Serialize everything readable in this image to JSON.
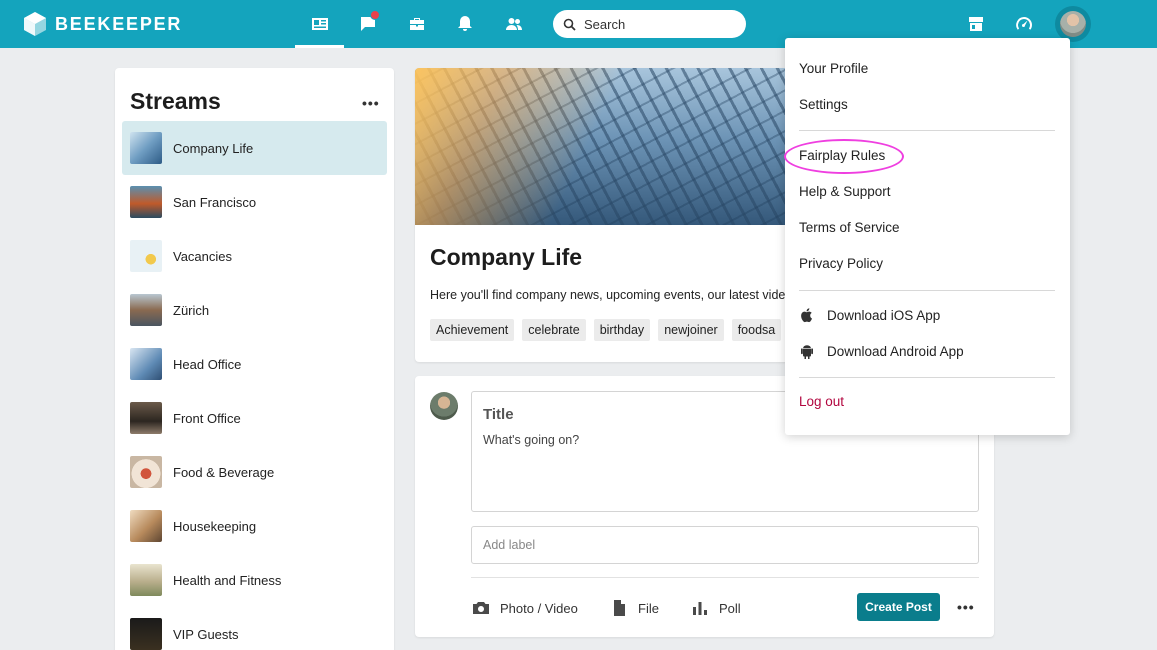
{
  "app": {
    "name": "BEEKEEPER"
  },
  "search": {
    "placeholder": "Search"
  },
  "streams": {
    "title": "Streams",
    "more_label": "•••",
    "items": [
      {
        "label": "Company Life",
        "active": true
      },
      {
        "label": "San Francisco"
      },
      {
        "label": "Vacancies"
      },
      {
        "label": "Zürich"
      },
      {
        "label": "Head Office"
      },
      {
        "label": "Front Office"
      },
      {
        "label": "Food & Beverage"
      },
      {
        "label": "Housekeeping"
      },
      {
        "label": "Health and Fitness"
      },
      {
        "label": "VIP Guests"
      }
    ]
  },
  "stream_header": {
    "title": "Company Life",
    "description": "Here you'll find company news, upcoming events, our latest vide",
    "tags": [
      "Achievement",
      "celebrate",
      "birthday",
      "newjoiner",
      "foodsa"
    ]
  },
  "composer": {
    "title_placeholder": "Title",
    "body_placeholder": "What's going on?",
    "label_placeholder": "Add label",
    "photo_label": "Photo / Video",
    "file_label": "File",
    "poll_label": "Poll",
    "create_label": "Create Post",
    "more_label": "•••"
  },
  "menu": {
    "your_profile": "Your Profile",
    "settings": "Settings",
    "fairplay_rules": "Fairplay Rules",
    "help_support": "Help & Support",
    "terms": "Terms of Service",
    "privacy": "Privacy Policy",
    "ios": "Download iOS App",
    "android": "Download Android App",
    "logout": "Log out"
  },
  "colors": {
    "topbar": "#14a4bd",
    "accent_button": "#0a7d8c",
    "logout": "#b2063f",
    "highlight": "#ef3fe0",
    "notification": "#e9404b"
  }
}
